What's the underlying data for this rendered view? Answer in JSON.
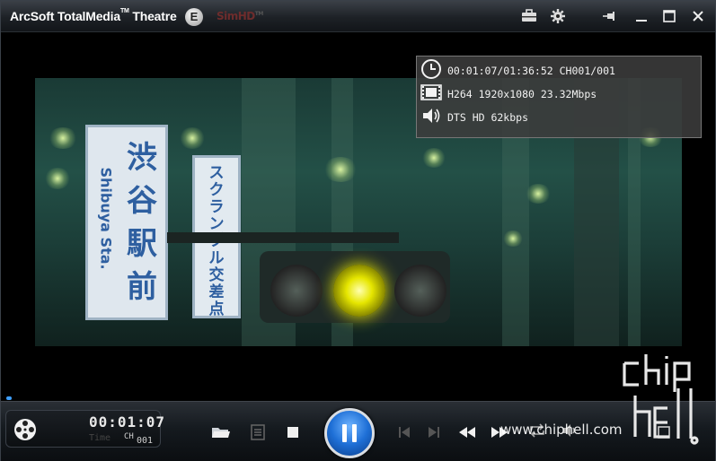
{
  "app": {
    "title": "ArcSoft TotalMedia",
    "title_suffix": "Theatre",
    "trademark": "TM",
    "edition_badge": "E",
    "simhd": "SimHD",
    "simhd_tm": "TM"
  },
  "titlebar_icons": [
    "toolbox-icon",
    "gear-icon",
    "pin-icon",
    "minimize-icon",
    "maximize-icon",
    "close-icon"
  ],
  "osd": {
    "time_line": "00:01:07/01:36:52 CH001/001",
    "video_line": "H264 1920x1080 23.32Mbps",
    "audio_line": "DTS HD 62kbps"
  },
  "video": {
    "sign_left_jp": [
      "渋",
      "谷",
      "駅",
      "前"
    ],
    "sign_left_en": "Shibuya Sta.",
    "sign_right_jp": [
      "ス",
      "ク",
      "ラ",
      "ン",
      "ブ",
      "ル",
      "交",
      "差",
      "点"
    ]
  },
  "playback": {
    "progress_fraction": 0.0115,
    "elapsed": "00:01:07",
    "time_label": "Time",
    "chapter_label": "CH",
    "chapter_number": "001"
  },
  "controls": [
    "open-folder-icon",
    "playlist-icon",
    "stop-icon",
    "pause-icon",
    "prev-chapter-icon",
    "next-chapter-icon",
    "rewind-icon",
    "fast-forward-icon",
    "repeat-icon",
    "volume-icon",
    "fullscreen-icon"
  ],
  "watermark": {
    "site": "www.chiphell.com",
    "logo_text": "chip hell"
  },
  "colors": {
    "accent": "#1e6fd6",
    "titlebar": "#1d2126",
    "osd_bg": "#3c3c3c"
  }
}
